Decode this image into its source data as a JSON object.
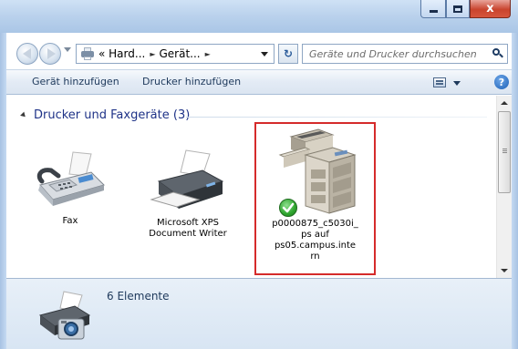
{
  "window": {
    "buttons": {
      "minimize_icon": "minimize-icon",
      "maximize_icon": "maximize-icon",
      "close_glyph": "x"
    }
  },
  "navbar": {
    "breadcrumbs": [
      {
        "label": "« Hard..."
      },
      {
        "label": "Gerät..."
      }
    ],
    "search_placeholder": "Geräte und Drucker durchsuchen",
    "refresh_glyph": "↻"
  },
  "commandbar": {
    "add_device": "Gerät hinzufügen",
    "add_printer": "Drucker hinzufügen",
    "help_glyph": "?"
  },
  "group": {
    "title": "Drucker und Faxgeräte (3)"
  },
  "devices": [
    {
      "label": "Fax"
    },
    {
      "label_lines": [
        "Microsoft XPS",
        "Document Writer"
      ]
    },
    {
      "label_lines": [
        "p0000875_c5030i_",
        "ps auf",
        "ps05.campus.inte",
        "rn"
      ],
      "selected": true,
      "default": true
    }
  ],
  "details": {
    "count": "6 Elemente"
  },
  "colors": {
    "accent_title": "#1e3287",
    "selection_border": "#d52b2b",
    "default_check": "#2ea52e"
  }
}
